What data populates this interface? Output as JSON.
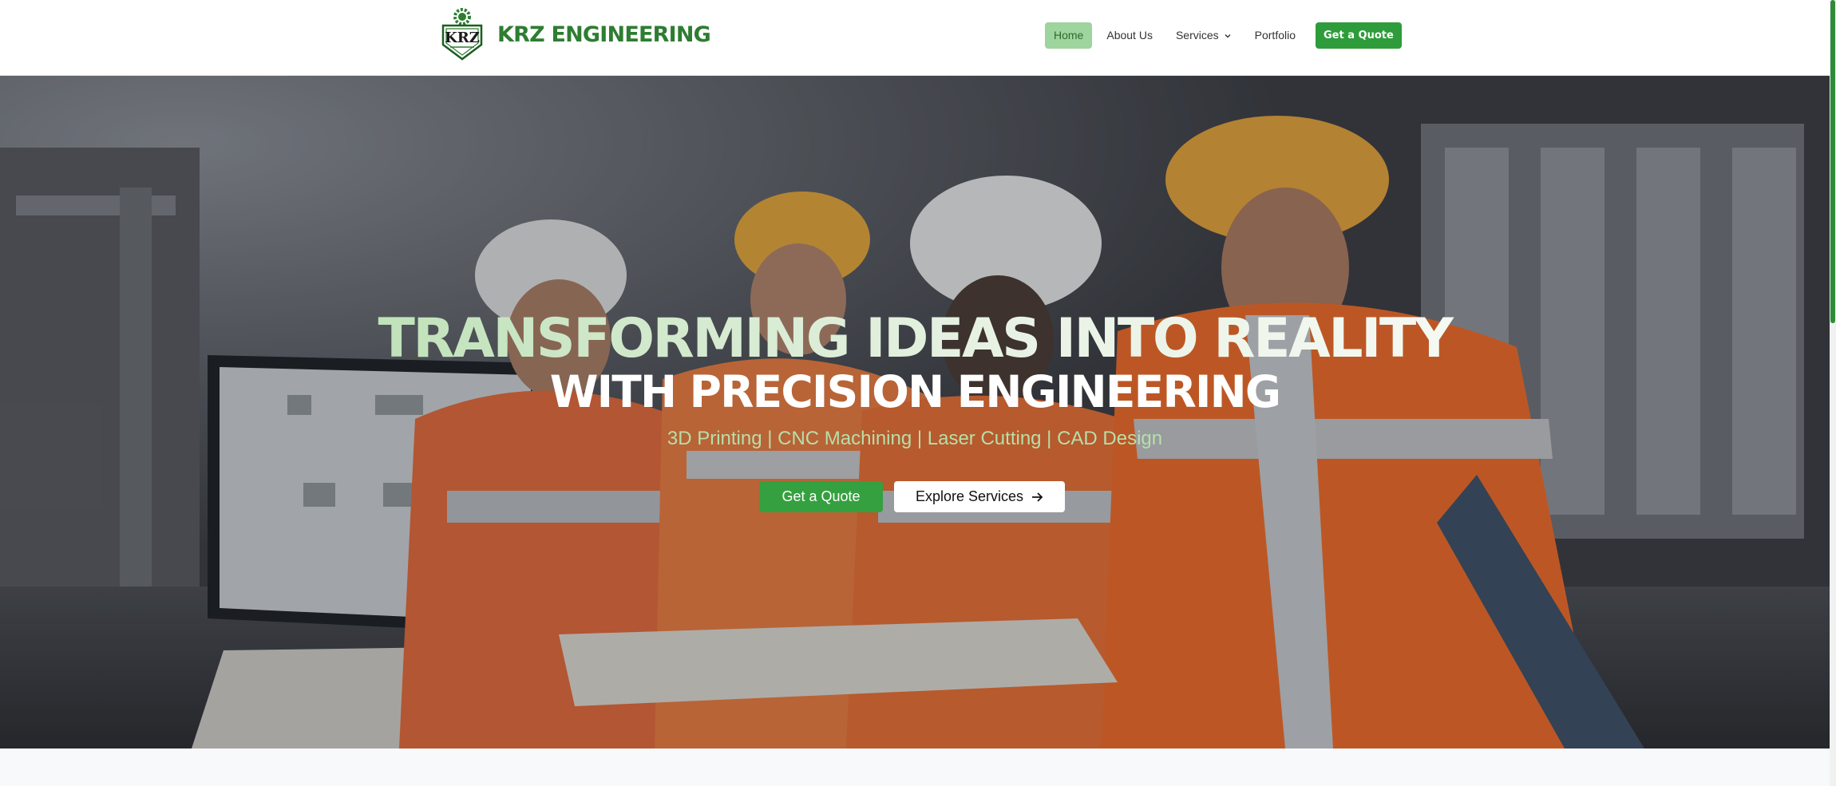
{
  "brand": {
    "name": "KRZ ENGINEERING",
    "logo_text": "KRZ"
  },
  "nav": {
    "items": [
      {
        "label": "Home",
        "active": true
      },
      {
        "label": "About Us",
        "active": false
      },
      {
        "label": "Services",
        "active": false,
        "has_dropdown": true
      },
      {
        "label": "Portfolio",
        "active": false
      }
    ],
    "cta_label": "Get a Quote"
  },
  "hero": {
    "headline_1": "TRANSFORMING IDEAS INTO REALITY",
    "headline_2": "WITH PRECISION ENGINEERING",
    "tagline": "3D Printing | CNC Machining | Laser Cutting | CAD Design",
    "primary_cta": "Get a Quote",
    "secondary_cta": "Explore Services",
    "background": "engineers-in-hard-hats-and-safety-vests"
  },
  "colors": {
    "brand_green": "#2e7d32",
    "accent_green": "#35a03f",
    "nav_active_bg": "#9ed49e"
  }
}
